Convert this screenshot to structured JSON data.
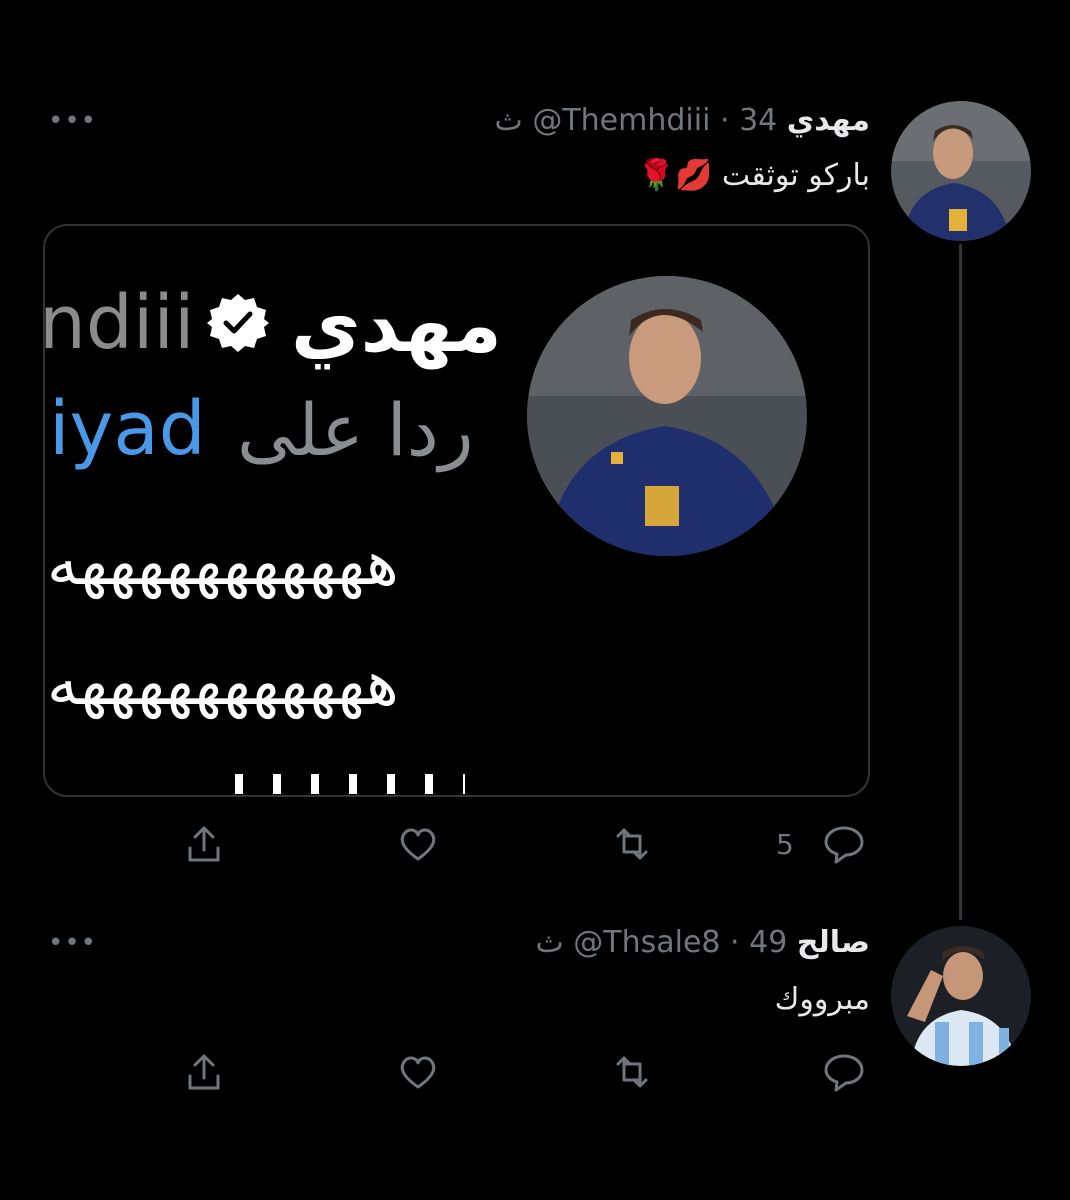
{
  "tweet1": {
    "name": "مهدي",
    "handle": "@Themhdiii",
    "separator": "·",
    "time": "34 ث",
    "text": "باركو توثقت 💋🌹",
    "more": "•••",
    "reply_count": "5"
  },
  "quoted_card": {
    "name": "مهدي",
    "handle_fragment": "ndiii",
    "reply_prefix": "ردا على",
    "reply_user_fragment": "iyad",
    "laugh_line_1": "هههههههههههه",
    "laugh_line_2": "هههههههههههه"
  },
  "tweet2": {
    "name": "صالح",
    "handle": "@Thsale8",
    "separator": "·",
    "time": "49 ث",
    "text": "مبرووك",
    "more": "•••"
  },
  "colors": {
    "background": "#000000",
    "text_primary": "#e7e9ea",
    "text_secondary": "#71767b",
    "link_blue": "#4a99e9"
  },
  "icons": {
    "share": "share-icon",
    "like": "heart-icon",
    "retweet": "retweet-icon",
    "reply": "reply-icon",
    "verified": "verified-badge-icon"
  }
}
